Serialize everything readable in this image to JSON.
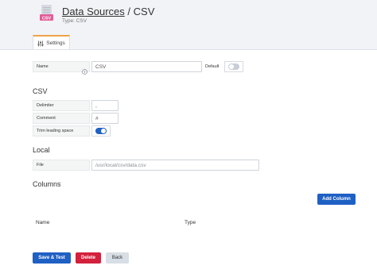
{
  "header": {
    "breadcrumb_link": "Data Sources",
    "separator": "/",
    "page_name": "CSV",
    "subtitle": "Type: CSV",
    "logo_badge": "CSV"
  },
  "tabs": [
    {
      "label": "Settings",
      "active": true,
      "icon": "sliders-icon"
    }
  ],
  "settings": {
    "name_label": "Name",
    "name_value": "CSV",
    "default_label": "Default",
    "default_enabled": false
  },
  "csv": {
    "section_title": "CSV",
    "delimiter_label": "Delimiter",
    "delimiter_value": ",",
    "comment_label": "Comment",
    "comment_value": "#",
    "trim_label": "Trim leading space",
    "trim_enabled": true
  },
  "local": {
    "section_title": "Local",
    "file_label": "File",
    "file_placeholder": "/usr/local/csv/data.csv"
  },
  "columns": {
    "section_title": "Columns",
    "add_button": "Add Column",
    "headers": [
      "Name",
      "Type"
    ]
  },
  "actions": {
    "save_test": "Save & Test",
    "delete": "Delete",
    "back": "Back"
  },
  "colors": {
    "primary": "#1f60c4",
    "danger": "#d3203c",
    "tab_accent": "#f0a348"
  }
}
